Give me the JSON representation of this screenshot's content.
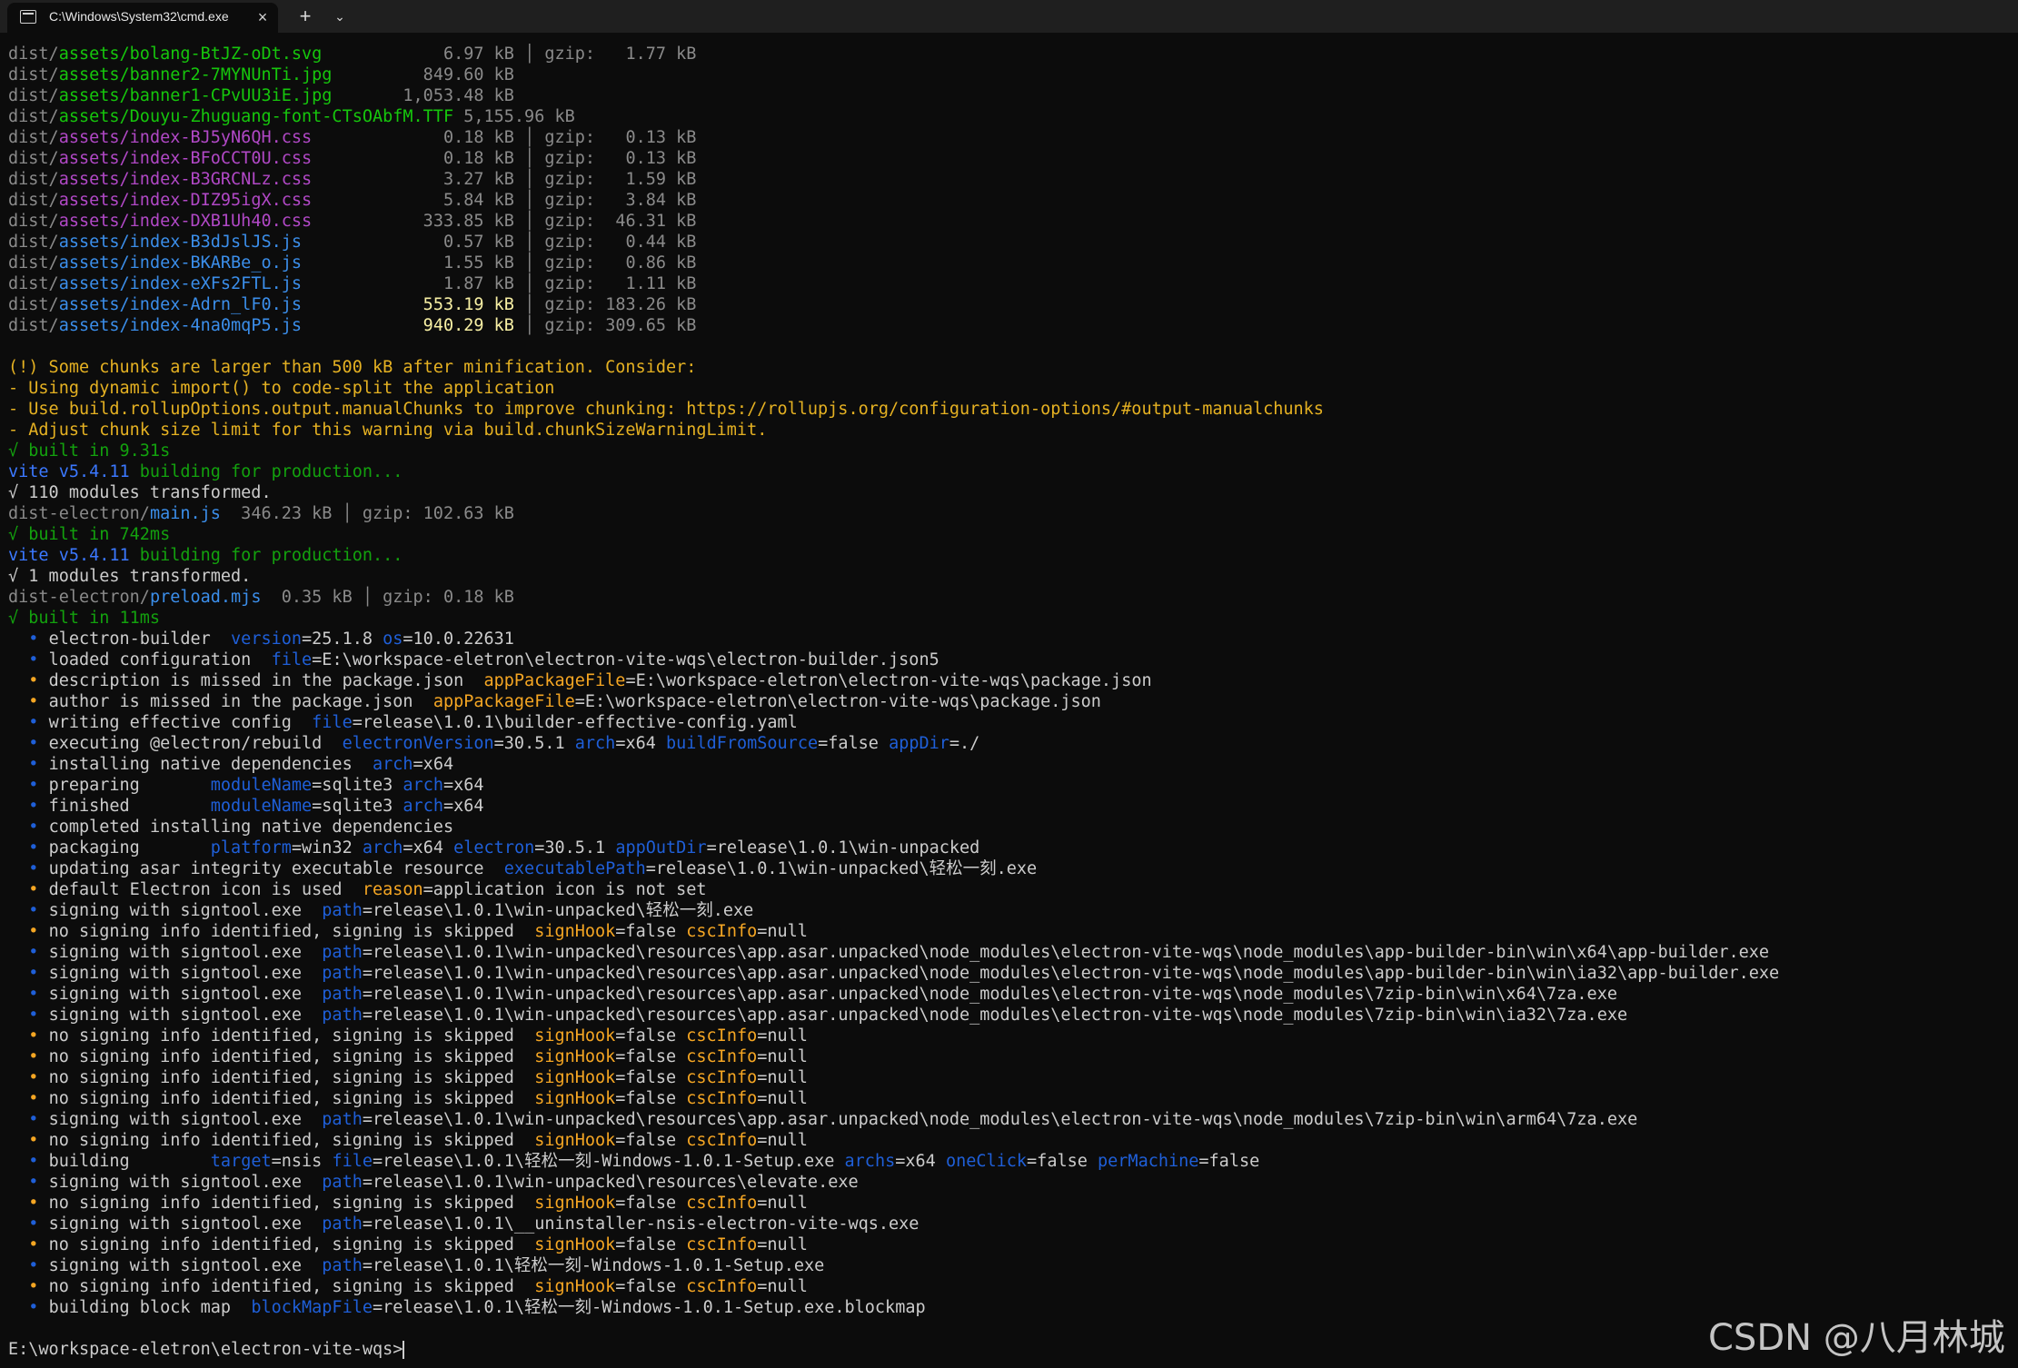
{
  "tab": {
    "title": "C:\\Windows\\System32\\cmd.exe",
    "close": "×",
    "new_tab": "+",
    "dropdown": "⌄"
  },
  "assets": [
    {
      "prefix": "dist/",
      "path": "assets/bolang-BtJZ-oDt.svg",
      "type": "asset",
      "size": "  6.97 kB",
      "gzip": "  1.77 kB"
    },
    {
      "prefix": "dist/",
      "path": "assets/banner2-7MYNUnTi.jpg",
      "type": "asset",
      "size": "849.60 kB",
      "gzip": ""
    },
    {
      "prefix": "dist/",
      "path": "assets/banner1-CPvUU3iE.jpg",
      "type": "asset",
      "size": "1,053.48 kB",
      "gzip": ""
    },
    {
      "prefix": "dist/",
      "path": "assets/Douyu-Zhuguang-font-CTsOAbfM.TTF",
      "type": "asset",
      "size": "5,155.96 kB",
      "gzip": ""
    },
    {
      "prefix": "dist/",
      "path": "assets/index-BJ5yN6QH.css",
      "type": "css",
      "size": "  0.18 kB",
      "gzip": "  0.13 kB"
    },
    {
      "prefix": "dist/",
      "path": "assets/index-BFoCCT0U.css",
      "type": "css",
      "size": "  0.18 kB",
      "gzip": "  0.13 kB"
    },
    {
      "prefix": "dist/",
      "path": "assets/index-B3GRCNLz.css",
      "type": "css",
      "size": "  3.27 kB",
      "gzip": "  1.59 kB"
    },
    {
      "prefix": "dist/",
      "path": "assets/index-DIZ95igX.css",
      "type": "css",
      "size": "  5.84 kB",
      "gzip": "  3.84 kB"
    },
    {
      "prefix": "dist/",
      "path": "assets/index-DXB1Uh40.css",
      "type": "css",
      "size": "333.85 kB",
      "gzip": " 46.31 kB"
    },
    {
      "prefix": "dist/",
      "path": "assets/index-B3dJslJS.js",
      "type": "js",
      "size": "  0.57 kB",
      "gzip": "  0.44 kB"
    },
    {
      "prefix": "dist/",
      "path": "assets/index-BKARBe_o.js",
      "type": "js",
      "size": "  1.55 kB",
      "gzip": "  0.86 kB"
    },
    {
      "prefix": "dist/",
      "path": "assets/index-eXFs2FTL.js",
      "type": "js",
      "size": "  1.87 kB",
      "gzip": "  1.11 kB"
    },
    {
      "prefix": "dist/",
      "path": "assets/index-Adrn_lF0.js",
      "type": "js",
      "size": "553.19 kB",
      "gzip": "183.26 kB",
      "large": true
    },
    {
      "prefix": "dist/",
      "path": "assets/index-4na0mqP5.js",
      "type": "js",
      "size": "940.29 kB",
      "gzip": "309.65 kB",
      "large": true
    }
  ],
  "gzip_label": "gzip:",
  "warnings": [
    "(!) Some chunks are larger than 500 kB after minification. Consider:",
    "- Using dynamic import() to code-split the application",
    "- Use build.rollupOptions.output.manualChunks to improve chunking: https://rollupjs.org/configuration-options/#output-manualchunks",
    "- Adjust chunk size limit for this warning via build.chunkSizeWarningLimit."
  ],
  "builds": {
    "built1": "√ built in 9.31s",
    "vite1": "vite v5.4.11",
    "vite1_rest": " building for production...",
    "modules1": "√ 110 modules transformed.",
    "main_prefix": "dist-electron/",
    "main_file": "main.js",
    "main_size": "  346.23 kB │ gzip: 102.63 kB",
    "built2": "√ built in 742ms",
    "vite2": "vite v5.4.11",
    "vite2_rest": " building for production...",
    "modules2": "√ 1 modules transformed.",
    "preload_prefix": "dist-electron/",
    "preload_file": "preload.mjs",
    "preload_size": "  0.35 kB │ gzip: 0.18 kB",
    "built3": "√ built in 11ms"
  },
  "log": [
    {
      "b": "blue",
      "segs": [
        [
          "t",
          "electron-builder  "
        ],
        [
          "k",
          "version"
        ],
        [
          "t",
          "=25.1.8 "
        ],
        [
          "k",
          "os"
        ],
        [
          "t",
          "=10.0.22631"
        ]
      ]
    },
    {
      "b": "blue",
      "segs": [
        [
          "t",
          "loaded configuration  "
        ],
        [
          "k",
          "file"
        ],
        [
          "t",
          "=E:\\workspace-eletron\\electron-vite-wqs\\electron-builder.json5"
        ]
      ]
    },
    {
      "b": "orange",
      "segs": [
        [
          "t",
          "description is missed in the package.json  "
        ],
        [
          "w",
          "appPackageFile"
        ],
        [
          "t",
          "=E:\\workspace-eletron\\electron-vite-wqs\\package.json"
        ]
      ]
    },
    {
      "b": "orange",
      "segs": [
        [
          "t",
          "author is missed in the package.json  "
        ],
        [
          "w",
          "appPackageFile"
        ],
        [
          "t",
          "=E:\\workspace-eletron\\electron-vite-wqs\\package.json"
        ]
      ]
    },
    {
      "b": "blue",
      "segs": [
        [
          "t",
          "writing effective config  "
        ],
        [
          "k",
          "file"
        ],
        [
          "t",
          "=release\\1.0.1\\builder-effective-config.yaml"
        ]
      ]
    },
    {
      "b": "blue",
      "segs": [
        [
          "t",
          "executing @electron/rebuild  "
        ],
        [
          "k",
          "electronVersion"
        ],
        [
          "t",
          "=30.5.1 "
        ],
        [
          "k",
          "arch"
        ],
        [
          "t",
          "=x64 "
        ],
        [
          "k",
          "buildFromSource"
        ],
        [
          "t",
          "=false "
        ],
        [
          "k",
          "appDir"
        ],
        [
          "t",
          "=./"
        ]
      ]
    },
    {
      "b": "blue",
      "segs": [
        [
          "t",
          "installing native dependencies  "
        ],
        [
          "k",
          "arch"
        ],
        [
          "t",
          "=x64"
        ]
      ]
    },
    {
      "b": "blue",
      "segs": [
        [
          "t",
          "preparing       "
        ],
        [
          "k",
          "moduleName"
        ],
        [
          "t",
          "=sqlite3 "
        ],
        [
          "k",
          "arch"
        ],
        [
          "t",
          "=x64"
        ]
      ]
    },
    {
      "b": "blue",
      "segs": [
        [
          "t",
          "finished        "
        ],
        [
          "k",
          "moduleName"
        ],
        [
          "t",
          "=sqlite3 "
        ],
        [
          "k",
          "arch"
        ],
        [
          "t",
          "=x64"
        ]
      ]
    },
    {
      "b": "blue",
      "segs": [
        [
          "t",
          "completed installing native dependencies"
        ]
      ]
    },
    {
      "b": "blue",
      "segs": [
        [
          "t",
          "packaging       "
        ],
        [
          "k",
          "platform"
        ],
        [
          "t",
          "=win32 "
        ],
        [
          "k",
          "arch"
        ],
        [
          "t",
          "=x64 "
        ],
        [
          "k",
          "electron"
        ],
        [
          "t",
          "=30.5.1 "
        ],
        [
          "k",
          "appOutDir"
        ],
        [
          "t",
          "=release\\1.0.1\\win-unpacked"
        ]
      ]
    },
    {
      "b": "blue",
      "segs": [
        [
          "t",
          "updating asar integrity executable resource  "
        ],
        [
          "k",
          "executablePath"
        ],
        [
          "t",
          "=release\\1.0.1\\win-unpacked\\轻松一刻.exe"
        ]
      ]
    },
    {
      "b": "orange",
      "segs": [
        [
          "t",
          "default Electron icon is used  "
        ],
        [
          "w",
          "reason"
        ],
        [
          "t",
          "=application icon is not set"
        ]
      ]
    },
    {
      "b": "blue",
      "segs": [
        [
          "t",
          "signing with signtool.exe  "
        ],
        [
          "k",
          "path"
        ],
        [
          "t",
          "=release\\1.0.1\\win-unpacked\\轻松一刻.exe"
        ]
      ]
    },
    {
      "b": "orange",
      "segs": [
        [
          "t",
          "no signing info identified, signing is skipped  "
        ],
        [
          "w",
          "signHook"
        ],
        [
          "t",
          "=false "
        ],
        [
          "w",
          "cscInfo"
        ],
        [
          "t",
          "=null"
        ]
      ]
    },
    {
      "b": "blue",
      "segs": [
        [
          "t",
          "signing with signtool.exe  "
        ],
        [
          "k",
          "path"
        ],
        [
          "t",
          "=release\\1.0.1\\win-unpacked\\resources\\app.asar.unpacked\\node_modules\\electron-vite-wqs\\node_modules\\app-builder-bin\\win\\x64\\app-builder.exe"
        ]
      ]
    },
    {
      "b": "blue",
      "segs": [
        [
          "t",
          "signing with signtool.exe  "
        ],
        [
          "k",
          "path"
        ],
        [
          "t",
          "=release\\1.0.1\\win-unpacked\\resources\\app.asar.unpacked\\node_modules\\electron-vite-wqs\\node_modules\\app-builder-bin\\win\\ia32\\app-builder.exe"
        ]
      ]
    },
    {
      "b": "blue",
      "segs": [
        [
          "t",
          "signing with signtool.exe  "
        ],
        [
          "k",
          "path"
        ],
        [
          "t",
          "=release\\1.0.1\\win-unpacked\\resources\\app.asar.unpacked\\node_modules\\electron-vite-wqs\\node_modules\\7zip-bin\\win\\x64\\7za.exe"
        ]
      ]
    },
    {
      "b": "blue",
      "segs": [
        [
          "t",
          "signing with signtool.exe  "
        ],
        [
          "k",
          "path"
        ],
        [
          "t",
          "=release\\1.0.1\\win-unpacked\\resources\\app.asar.unpacked\\node_modules\\electron-vite-wqs\\node_modules\\7zip-bin\\win\\ia32\\7za.exe"
        ]
      ]
    },
    {
      "b": "orange",
      "segs": [
        [
          "t",
          "no signing info identified, signing is skipped  "
        ],
        [
          "w",
          "signHook"
        ],
        [
          "t",
          "=false "
        ],
        [
          "w",
          "cscInfo"
        ],
        [
          "t",
          "=null"
        ]
      ]
    },
    {
      "b": "orange",
      "segs": [
        [
          "t",
          "no signing info identified, signing is skipped  "
        ],
        [
          "w",
          "signHook"
        ],
        [
          "t",
          "=false "
        ],
        [
          "w",
          "cscInfo"
        ],
        [
          "t",
          "=null"
        ]
      ]
    },
    {
      "b": "orange",
      "segs": [
        [
          "t",
          "no signing info identified, signing is skipped  "
        ],
        [
          "w",
          "signHook"
        ],
        [
          "t",
          "=false "
        ],
        [
          "w",
          "cscInfo"
        ],
        [
          "t",
          "=null"
        ]
      ]
    },
    {
      "b": "orange",
      "segs": [
        [
          "t",
          "no signing info identified, signing is skipped  "
        ],
        [
          "w",
          "signHook"
        ],
        [
          "t",
          "=false "
        ],
        [
          "w",
          "cscInfo"
        ],
        [
          "t",
          "=null"
        ]
      ]
    },
    {
      "b": "blue",
      "segs": [
        [
          "t",
          "signing with signtool.exe  "
        ],
        [
          "k",
          "path"
        ],
        [
          "t",
          "=release\\1.0.1\\win-unpacked\\resources\\app.asar.unpacked\\node_modules\\electron-vite-wqs\\node_modules\\7zip-bin\\win\\arm64\\7za.exe"
        ]
      ]
    },
    {
      "b": "orange",
      "segs": [
        [
          "t",
          "no signing info identified, signing is skipped  "
        ],
        [
          "w",
          "signHook"
        ],
        [
          "t",
          "=false "
        ],
        [
          "w",
          "cscInfo"
        ],
        [
          "t",
          "=null"
        ]
      ]
    },
    {
      "b": "blue",
      "segs": [
        [
          "t",
          "building        "
        ],
        [
          "k",
          "target"
        ],
        [
          "t",
          "=nsis "
        ],
        [
          "k",
          "file"
        ],
        [
          "t",
          "=release\\1.0.1\\轻松一刻-Windows-1.0.1-Setup.exe "
        ],
        [
          "k",
          "archs"
        ],
        [
          "t",
          "=x64 "
        ],
        [
          "k",
          "oneClick"
        ],
        [
          "t",
          "=false "
        ],
        [
          "k",
          "perMachine"
        ],
        [
          "t",
          "=false"
        ]
      ]
    },
    {
      "b": "blue",
      "segs": [
        [
          "t",
          "signing with signtool.exe  "
        ],
        [
          "k",
          "path"
        ],
        [
          "t",
          "=release\\1.0.1\\win-unpacked\\resources\\elevate.exe"
        ]
      ]
    },
    {
      "b": "orange",
      "segs": [
        [
          "t",
          "no signing info identified, signing is skipped  "
        ],
        [
          "w",
          "signHook"
        ],
        [
          "t",
          "=false "
        ],
        [
          "w",
          "cscInfo"
        ],
        [
          "t",
          "=null"
        ]
      ]
    },
    {
      "b": "blue",
      "segs": [
        [
          "t",
          "signing with signtool.exe  "
        ],
        [
          "k",
          "path"
        ],
        [
          "t",
          "=release\\1.0.1\\__uninstaller-nsis-electron-vite-wqs.exe"
        ]
      ]
    },
    {
      "b": "orange",
      "segs": [
        [
          "t",
          "no signing info identified, signing is skipped  "
        ],
        [
          "w",
          "signHook"
        ],
        [
          "t",
          "=false "
        ],
        [
          "w",
          "cscInfo"
        ],
        [
          "t",
          "=null"
        ]
      ]
    },
    {
      "b": "blue",
      "segs": [
        [
          "t",
          "signing with signtool.exe  "
        ],
        [
          "k",
          "path"
        ],
        [
          "t",
          "=release\\1.0.1\\轻松一刻-Windows-1.0.1-Setup.exe"
        ]
      ]
    },
    {
      "b": "orange",
      "segs": [
        [
          "t",
          "no signing info identified, signing is skipped  "
        ],
        [
          "w",
          "signHook"
        ],
        [
          "t",
          "=false "
        ],
        [
          "w",
          "cscInfo"
        ],
        [
          "t",
          "=null"
        ]
      ]
    },
    {
      "b": "blue",
      "segs": [
        [
          "t",
          "building block map  "
        ],
        [
          "k",
          "blockMapFile"
        ],
        [
          "t",
          "=release\\1.0.1\\轻松一刻-Windows-1.0.1-Setup.exe.blockmap"
        ]
      ]
    }
  ],
  "bullet": "•",
  "prompt": "E:\\workspace-eletron\\electron-vite-wqs>",
  "watermark": "CSDN @八月林城",
  "colors": {
    "background": "#0c0c0c",
    "titlebar": "#1f1f1f",
    "green": "#16c60c",
    "warning": "#e5b122"
  }
}
